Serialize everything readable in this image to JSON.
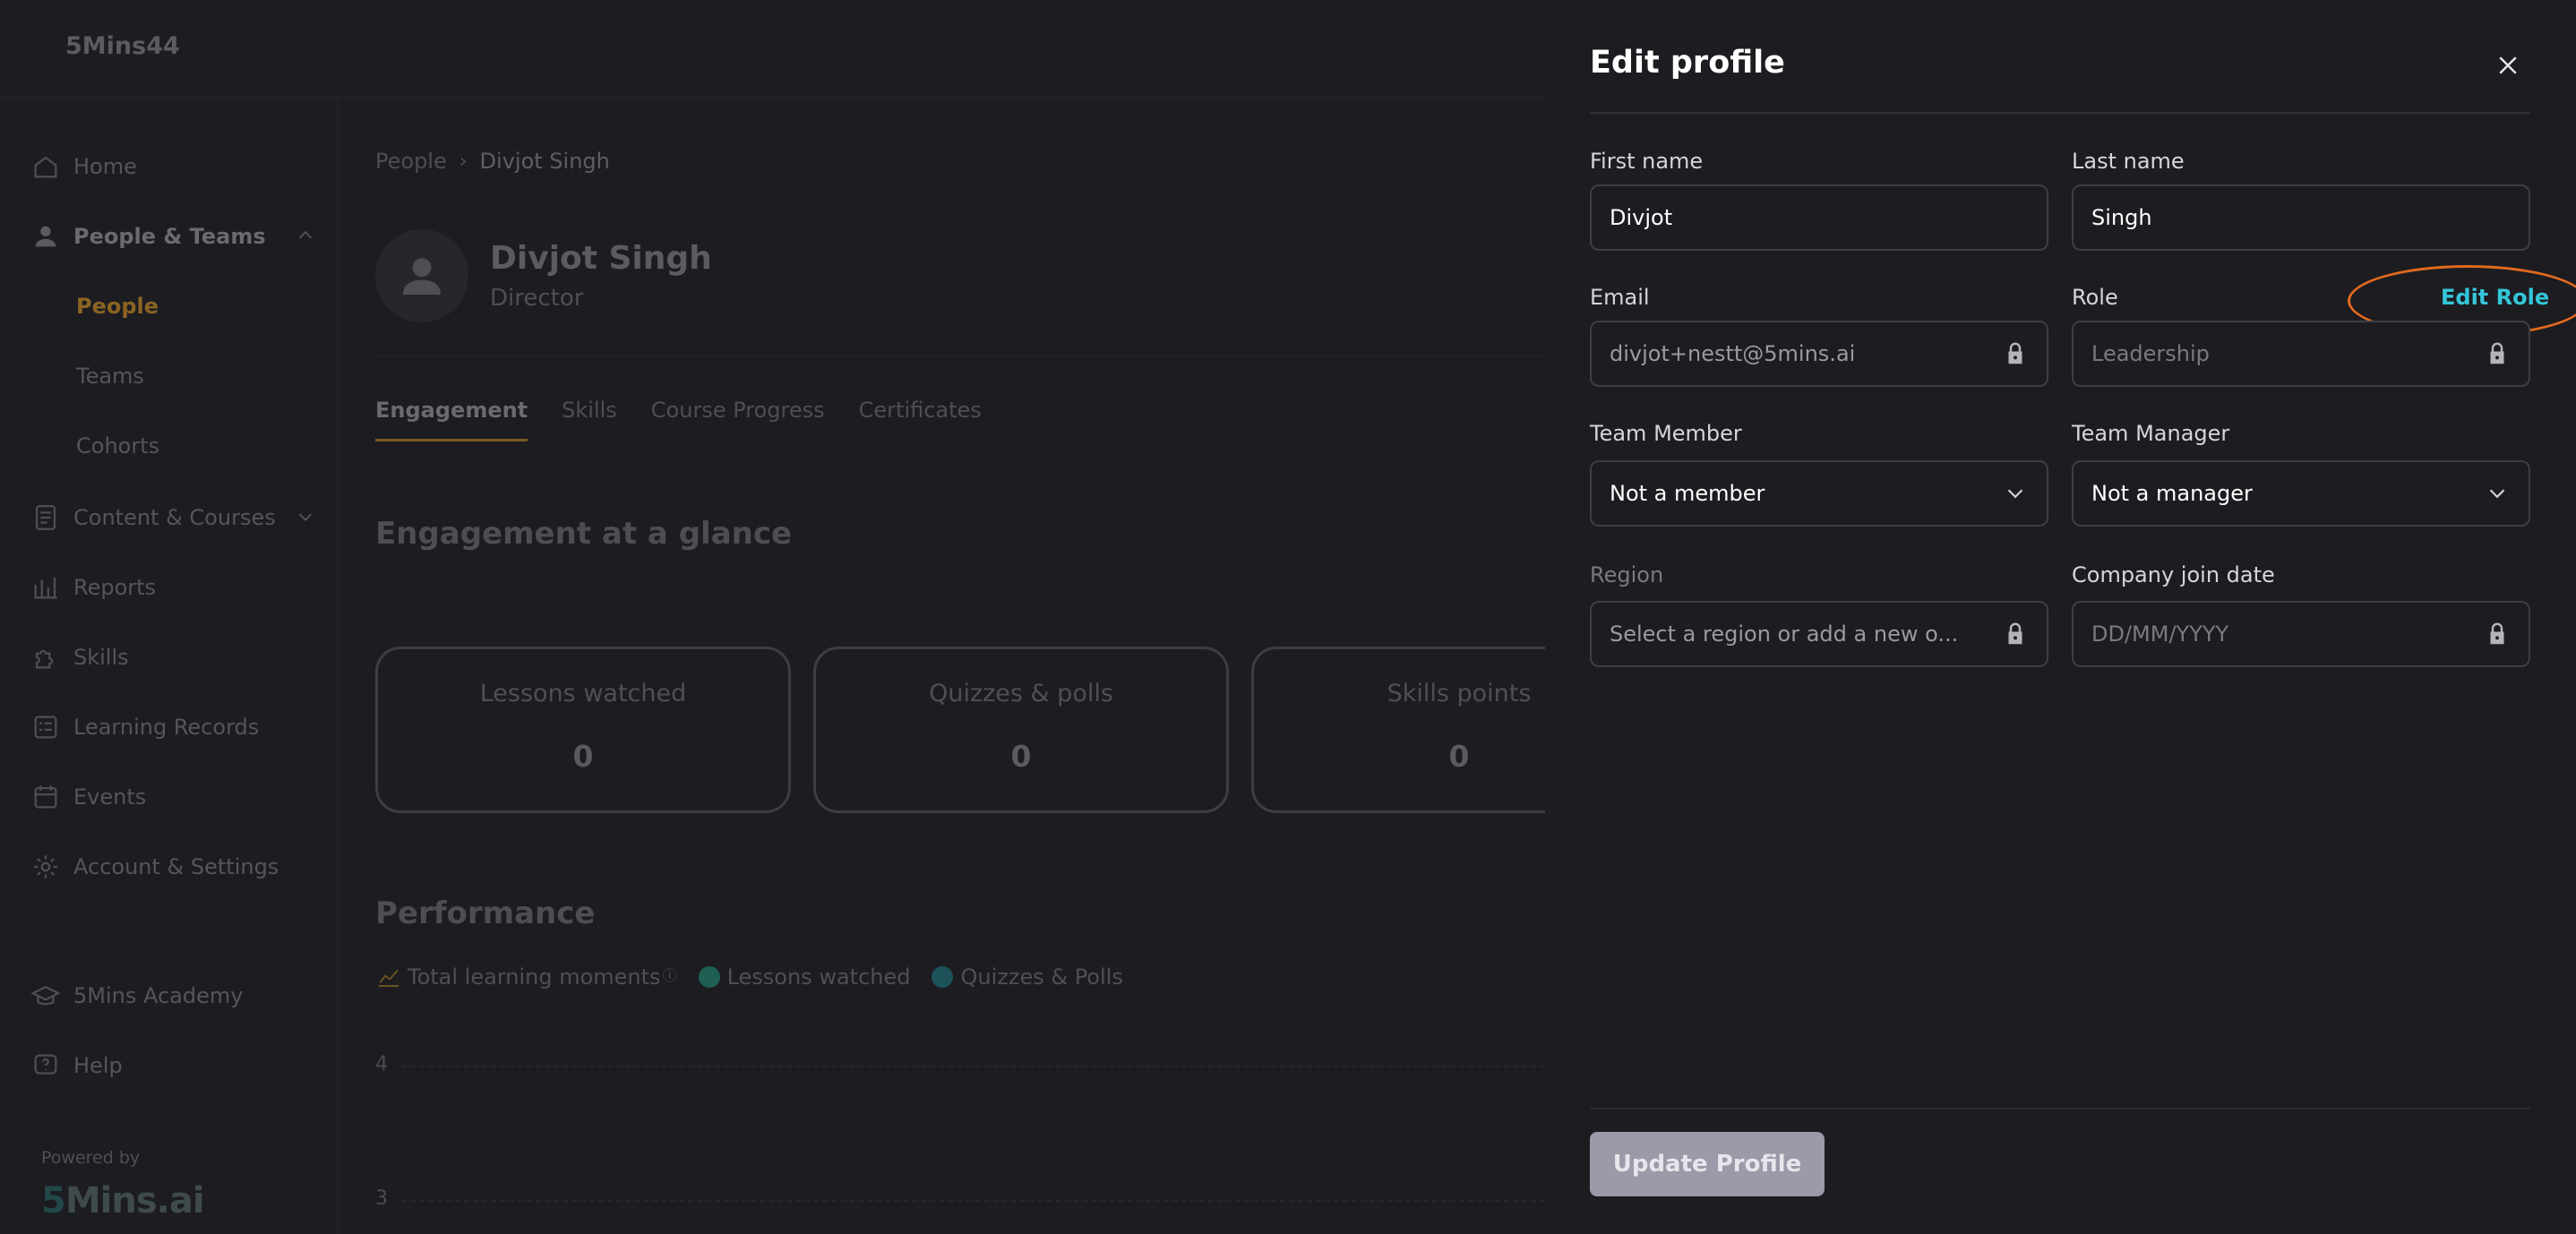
{
  "app": {
    "brand": "5Mins44"
  },
  "sidebar": {
    "items": [
      {
        "label": "Home",
        "icon": "home-icon"
      },
      {
        "label": "People & Teams",
        "icon": "person-icon"
      },
      {
        "label": "Content & Courses",
        "icon": "document-icon"
      },
      {
        "label": "Reports",
        "icon": "bar-chart-icon"
      },
      {
        "label": "Skills",
        "icon": "puzzle-icon"
      },
      {
        "label": "Learning Records",
        "icon": "records-icon"
      },
      {
        "label": "Events",
        "icon": "calendar-icon"
      },
      {
        "label": "Account & Settings",
        "icon": "gear-icon"
      },
      {
        "label": "5Mins Academy",
        "icon": "graduation-cap-icon"
      },
      {
        "label": "Help",
        "icon": "help-icon"
      }
    ],
    "sub_items": [
      "People",
      "Teams",
      "Cohorts"
    ],
    "powered_by": "Powered by",
    "powered_logo_prefix": "5",
    "powered_logo_rest": "Mins.ai"
  },
  "main": {
    "breadcrumb": {
      "root": "People",
      "current": "Divjot Singh"
    },
    "profile": {
      "name": "Divjot Singh",
      "title": "Director"
    },
    "tabs": [
      "Engagement",
      "Skills",
      "Course Progress",
      "Certificates"
    ],
    "engagement_title": "Engagement at a glance",
    "stats": [
      {
        "label": "Lessons watched",
        "value": "0"
      },
      {
        "label": "Quizzes & polls",
        "value": "0"
      },
      {
        "label": "Skills points",
        "value": "0"
      }
    ],
    "performance_title": "Performance",
    "legend": {
      "total": "Total learning moments",
      "info": "ⓘ",
      "lessons": "Lessons watched",
      "quizzes": "Quizzes & Polls"
    },
    "y_ticks": [
      "4",
      "3"
    ]
  },
  "drawer": {
    "title": "Edit profile",
    "first_name": {
      "label": "First name",
      "value": "Divjot"
    },
    "last_name": {
      "label": "Last name",
      "value": "Singh"
    },
    "email": {
      "label": "Email",
      "value": "divjot+nestt@5mins.ai"
    },
    "role": {
      "label": "Role",
      "value": "Leadership",
      "edit_label": "Edit Role"
    },
    "team_member": {
      "label": "Team Member",
      "value": "Not a member"
    },
    "team_manager": {
      "label": "Team Manager",
      "value": "Not a manager"
    },
    "region": {
      "label": "Region",
      "placeholder": "Select a region or add a new o..."
    },
    "join_date": {
      "label": "Company join date",
      "placeholder": "DD/MM/YYYY"
    },
    "update_label": "Update Profile"
  },
  "colors": {
    "accent": "#8a6422",
    "edit_role": "#34c6d8",
    "highlight_oval": "#e36a1e",
    "lessons_dot": "#1f6d5e",
    "quizzes_dot": "#1d5f66"
  }
}
